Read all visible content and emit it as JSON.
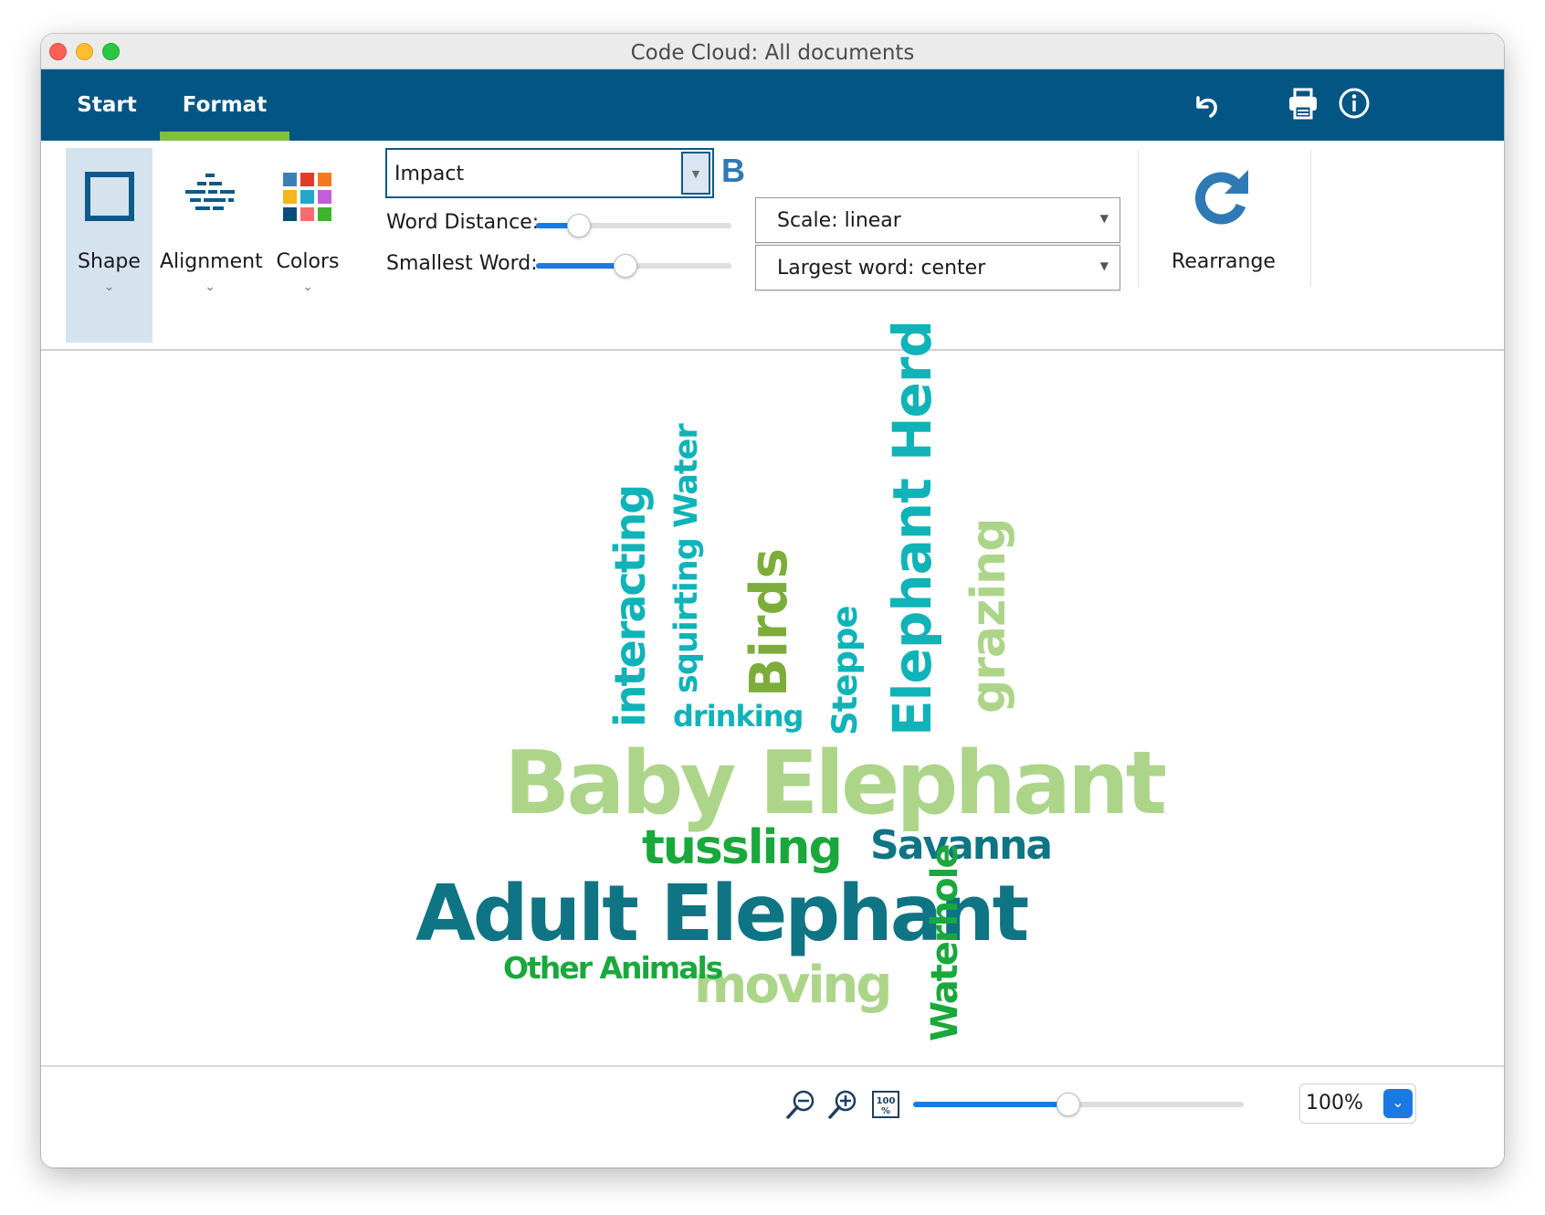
{
  "window": {
    "title": "Code Cloud: All documents"
  },
  "tabs": [
    {
      "label": "Start"
    },
    {
      "label": "Format"
    }
  ],
  "toolbar": {
    "undo_icon": "undo-icon",
    "print_icon": "printer-icon",
    "info_icon": "info-icon"
  },
  "ribbon": {
    "shape_label": "Shape",
    "alignment_label": "Alignment",
    "colors_label": "Colors",
    "font_value": "Impact",
    "bold_label": "B",
    "word_distance_label": "Word Distance:",
    "word_distance_value": 0.22,
    "smallest_word_label": "Smallest Word:",
    "smallest_word_value": 0.46,
    "scale_value": "Scale: linear",
    "largest_word_value": "Largest word: center",
    "rearrange_label": "Rearrange"
  },
  "cloud": {
    "words": [
      {
        "text": "Baby Elephant",
        "color": "#add58a"
      },
      {
        "text": "Adult Elephant",
        "color": "#0f7483"
      },
      {
        "text": "Elephant Herd",
        "color": "#0fb3b8"
      },
      {
        "text": "tussling",
        "color": "#1aa83c"
      },
      {
        "text": "Savanna",
        "color": "#0f7483"
      },
      {
        "text": "moving",
        "color": "#add58a"
      },
      {
        "text": "Other Animals",
        "color": "#1aa83c"
      },
      {
        "text": "Waterhole",
        "color": "#1aa83c"
      },
      {
        "text": "interacting",
        "color": "#0fb3b8"
      },
      {
        "text": "squirting Water",
        "color": "#0fb3b8"
      },
      {
        "text": "Birds",
        "color": "#7cad3a"
      },
      {
        "text": "drinking",
        "color": "#0fb3b8"
      },
      {
        "text": "Steppe",
        "color": "#0fb3b8"
      },
      {
        "text": "grazing",
        "color": "#add58a"
      }
    ]
  },
  "zoom": {
    "value": "100%",
    "level": 0.47,
    "zoom_out_icon": "zoom-out-icon",
    "zoom_in_icon": "zoom-in-icon",
    "fit_icon": "zoom-100-icon"
  }
}
